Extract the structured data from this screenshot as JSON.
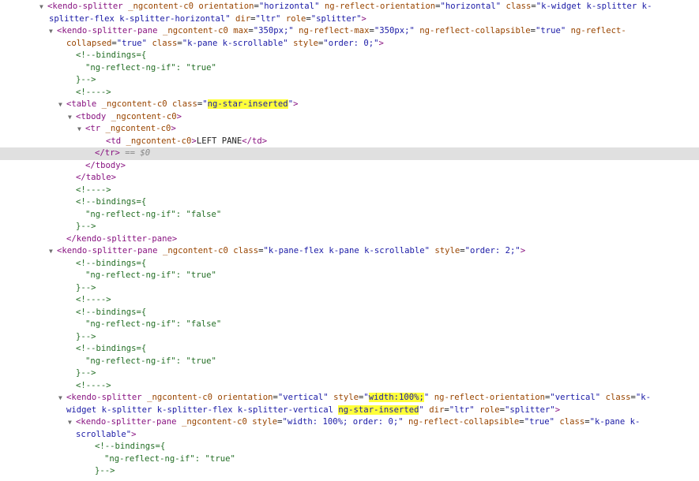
{
  "colors": {
    "tag": "#881280",
    "attr_name": "#994500",
    "attr_value": "#1a1aa6",
    "comment": "#236e25",
    "selected_row_bg": "#e0e0e0",
    "search_highlight": "#ffff3a"
  },
  "icons": {
    "expanded": "triangle-down-icon"
  },
  "lines": [
    {
      "indent": 62,
      "tri": true,
      "sel": false,
      "parts": [
        {
          "t": "tg",
          "v": "<kendo-splitter "
        },
        {
          "t": "an",
          "v": "_ngcontent-c0 orientation"
        },
        {
          "t": "tx",
          "v": "="
        },
        {
          "t": "av",
          "v": "\"horizontal\" "
        },
        {
          "t": "an",
          "v": "ng-reflect-orientation"
        },
        {
          "t": "tx",
          "v": "="
        },
        {
          "t": "av",
          "v": "\"horizontal\" "
        },
        {
          "t": "an",
          "v": "class"
        },
        {
          "t": "tx",
          "v": "="
        },
        {
          "t": "av",
          "v": "\"k-widget k-splitter k-"
        }
      ]
    },
    {
      "indent": 62,
      "tri": false,
      "sel": false,
      "parts": [
        {
          "t": "av",
          "v": "splitter-flex k-splitter-horizontal\" "
        },
        {
          "t": "an",
          "v": "dir"
        },
        {
          "t": "tx",
          "v": "="
        },
        {
          "t": "av",
          "v": "\"ltr\" "
        },
        {
          "t": "an",
          "v": "role"
        },
        {
          "t": "tx",
          "v": "="
        },
        {
          "t": "av",
          "v": "\"splitter\""
        },
        {
          "t": "tg",
          "v": ">"
        }
      ]
    },
    {
      "indent": 74,
      "tri": true,
      "sel": false,
      "parts": [
        {
          "t": "tg",
          "v": "<kendo-splitter-pane "
        },
        {
          "t": "an",
          "v": "_ngcontent-c0 max"
        },
        {
          "t": "tx",
          "v": "="
        },
        {
          "t": "av",
          "v": "\"350px;\" "
        },
        {
          "t": "an",
          "v": "ng-reflect-max"
        },
        {
          "t": "tx",
          "v": "="
        },
        {
          "t": "av",
          "v": "\"350px;\" "
        },
        {
          "t": "an",
          "v": "ng-reflect-collapsible"
        },
        {
          "t": "tx",
          "v": "="
        },
        {
          "t": "av",
          "v": "\"true\" "
        },
        {
          "t": "an",
          "v": "ng-reflect-"
        }
      ]
    },
    {
      "indent": 84,
      "tri": false,
      "sel": false,
      "parts": [
        {
          "t": "an",
          "v": "collapsed"
        },
        {
          "t": "tx",
          "v": "="
        },
        {
          "t": "av",
          "v": "\"true\" "
        },
        {
          "t": "an",
          "v": "class"
        },
        {
          "t": "tx",
          "v": "="
        },
        {
          "t": "av",
          "v": "\"k-pane k-scrollable\" "
        },
        {
          "t": "an",
          "v": "style"
        },
        {
          "t": "tx",
          "v": "="
        },
        {
          "t": "av",
          "v": "\"order: 0;\""
        },
        {
          "t": "tg",
          "v": ">"
        }
      ]
    },
    {
      "indent": 96,
      "tri": false,
      "sel": false,
      "parts": [
        {
          "t": "cm",
          "v": "<!--bindings={"
        }
      ]
    },
    {
      "indent": 108,
      "tri": false,
      "sel": false,
      "parts": [
        {
          "t": "cm",
          "v": "\"ng-reflect-ng-if\": \"true\""
        }
      ]
    },
    {
      "indent": 96,
      "tri": false,
      "sel": false,
      "parts": [
        {
          "t": "cm",
          "v": "}-->"
        }
      ]
    },
    {
      "indent": 96,
      "tri": false,
      "sel": false,
      "parts": [
        {
          "t": "cm",
          "v": "<!---->"
        }
      ]
    },
    {
      "indent": 86,
      "tri": true,
      "sel": false,
      "parts": [
        {
          "t": "tg",
          "v": "<table "
        },
        {
          "t": "an",
          "v": "_ngcontent-c0 class"
        },
        {
          "t": "tx",
          "v": "="
        },
        {
          "t": "av",
          "v": "\""
        },
        {
          "t": "av",
          "v": "ng-star-inserted",
          "hl": true
        },
        {
          "t": "av",
          "v": "\""
        },
        {
          "t": "tg",
          "v": ">"
        }
      ]
    },
    {
      "indent": 98,
      "tri": true,
      "sel": false,
      "parts": [
        {
          "t": "tg",
          "v": "<tbody "
        },
        {
          "t": "an",
          "v": "_ngcontent-c0"
        },
        {
          "t": "tg",
          "v": ">"
        }
      ]
    },
    {
      "indent": 110,
      "tri": true,
      "sel": false,
      "parts": [
        {
          "t": "tg",
          "v": "<tr "
        },
        {
          "t": "an",
          "v": "_ngcontent-c0"
        },
        {
          "t": "tg",
          "v": ">"
        }
      ]
    },
    {
      "indent": 134,
      "tri": false,
      "sel": false,
      "parts": [
        {
          "t": "tg",
          "v": "<td "
        },
        {
          "t": "an",
          "v": "_ngcontent-c0"
        },
        {
          "t": "tg",
          "v": ">"
        },
        {
          "t": "tx",
          "v": "LEFT PANE"
        },
        {
          "t": "tg",
          "v": "</td>"
        }
      ]
    },
    {
      "indent": 120,
      "tri": false,
      "sel": true,
      "parts": [
        {
          "t": "tg",
          "v": "</tr>"
        },
        {
          "t": "eq",
          "v": " == $0"
        }
      ]
    },
    {
      "indent": 108,
      "tri": false,
      "sel": false,
      "parts": [
        {
          "t": "tg",
          "v": "</tbody>"
        }
      ]
    },
    {
      "indent": 96,
      "tri": false,
      "sel": false,
      "parts": [
        {
          "t": "tg",
          "v": "</table>"
        }
      ]
    },
    {
      "indent": 96,
      "tri": false,
      "sel": false,
      "parts": [
        {
          "t": "cm",
          "v": "<!---->"
        }
      ]
    },
    {
      "indent": 96,
      "tri": false,
      "sel": false,
      "parts": [
        {
          "t": "cm",
          "v": "<!--bindings={"
        }
      ]
    },
    {
      "indent": 108,
      "tri": false,
      "sel": false,
      "parts": [
        {
          "t": "cm",
          "v": "\"ng-reflect-ng-if\": \"false\""
        }
      ]
    },
    {
      "indent": 96,
      "tri": false,
      "sel": false,
      "parts": [
        {
          "t": "cm",
          "v": "}-->"
        }
      ]
    },
    {
      "indent": 84,
      "tri": false,
      "sel": false,
      "parts": [
        {
          "t": "tg",
          "v": "</kendo-splitter-pane>"
        }
      ]
    },
    {
      "indent": 74,
      "tri": true,
      "sel": false,
      "parts": [
        {
          "t": "tg",
          "v": "<kendo-splitter-pane "
        },
        {
          "t": "an",
          "v": "_ngcontent-c0 class"
        },
        {
          "t": "tx",
          "v": "="
        },
        {
          "t": "av",
          "v": "\"k-pane-flex k-pane k-scrollable\" "
        },
        {
          "t": "an",
          "v": "style"
        },
        {
          "t": "tx",
          "v": "="
        },
        {
          "t": "av",
          "v": "\"order: 2;\""
        },
        {
          "t": "tg",
          "v": ">"
        }
      ]
    },
    {
      "indent": 96,
      "tri": false,
      "sel": false,
      "parts": [
        {
          "t": "cm",
          "v": "<!--bindings={"
        }
      ]
    },
    {
      "indent": 108,
      "tri": false,
      "sel": false,
      "parts": [
        {
          "t": "cm",
          "v": "\"ng-reflect-ng-if\": \"true\""
        }
      ]
    },
    {
      "indent": 96,
      "tri": false,
      "sel": false,
      "parts": [
        {
          "t": "cm",
          "v": "}-->"
        }
      ]
    },
    {
      "indent": 96,
      "tri": false,
      "sel": false,
      "parts": [
        {
          "t": "cm",
          "v": "<!---->"
        }
      ]
    },
    {
      "indent": 96,
      "tri": false,
      "sel": false,
      "parts": [
        {
          "t": "cm",
          "v": "<!--bindings={"
        }
      ]
    },
    {
      "indent": 108,
      "tri": false,
      "sel": false,
      "parts": [
        {
          "t": "cm",
          "v": "\"ng-reflect-ng-if\": \"false\""
        }
      ]
    },
    {
      "indent": 96,
      "tri": false,
      "sel": false,
      "parts": [
        {
          "t": "cm",
          "v": "}-->"
        }
      ]
    },
    {
      "indent": 96,
      "tri": false,
      "sel": false,
      "parts": [
        {
          "t": "cm",
          "v": "<!--bindings={"
        }
      ]
    },
    {
      "indent": 108,
      "tri": false,
      "sel": false,
      "parts": [
        {
          "t": "cm",
          "v": "\"ng-reflect-ng-if\": \"true\""
        }
      ]
    },
    {
      "indent": 96,
      "tri": false,
      "sel": false,
      "parts": [
        {
          "t": "cm",
          "v": "}-->"
        }
      ]
    },
    {
      "indent": 96,
      "tri": false,
      "sel": false,
      "parts": [
        {
          "t": "cm",
          "v": "<!---->"
        }
      ]
    },
    {
      "indent": 86,
      "tri": true,
      "sel": false,
      "parts": [
        {
          "t": "tg",
          "v": "<kendo-splitter "
        },
        {
          "t": "an",
          "v": "_ngcontent-c0 orientation"
        },
        {
          "t": "tx",
          "v": "="
        },
        {
          "t": "av",
          "v": "\"vertical\" "
        },
        {
          "t": "an",
          "v": "style"
        },
        {
          "t": "tx",
          "v": "="
        },
        {
          "t": "av",
          "v": "\""
        },
        {
          "t": "av",
          "v": "width:100%;",
          "hl": true
        },
        {
          "t": "av",
          "v": "\" "
        },
        {
          "t": "an",
          "v": "ng-reflect-orientation"
        },
        {
          "t": "tx",
          "v": "="
        },
        {
          "t": "av",
          "v": "\"vertical\" "
        },
        {
          "t": "an",
          "v": "class"
        },
        {
          "t": "tx",
          "v": "="
        },
        {
          "t": "av",
          "v": "\"k-"
        }
      ]
    },
    {
      "indent": 84,
      "tri": false,
      "sel": false,
      "parts": [
        {
          "t": "av",
          "v": "widget k-splitter k-splitter-flex k-splitter-vertical "
        },
        {
          "t": "av",
          "v": "ng-star-inserted",
          "hl": true
        },
        {
          "t": "av",
          "v": "\" "
        },
        {
          "t": "an",
          "v": "dir"
        },
        {
          "t": "tx",
          "v": "="
        },
        {
          "t": "av",
          "v": "\"ltr\" "
        },
        {
          "t": "an",
          "v": "role"
        },
        {
          "t": "tx",
          "v": "="
        },
        {
          "t": "av",
          "v": "\"splitter\""
        },
        {
          "t": "tg",
          "v": ">"
        }
      ]
    },
    {
      "indent": 98,
      "tri": true,
      "sel": false,
      "parts": [
        {
          "t": "tg",
          "v": "<kendo-splitter-pane "
        },
        {
          "t": "an",
          "v": "_ngcontent-c0 style"
        },
        {
          "t": "tx",
          "v": "="
        },
        {
          "t": "av",
          "v": "\"width: 100%; order: 0;\" "
        },
        {
          "t": "an",
          "v": "ng-reflect-collapsible"
        },
        {
          "t": "tx",
          "v": "="
        },
        {
          "t": "av",
          "v": "\"true\" "
        },
        {
          "t": "an",
          "v": "class"
        },
        {
          "t": "tx",
          "v": "="
        },
        {
          "t": "av",
          "v": "\"k-pane k-"
        }
      ]
    },
    {
      "indent": 96,
      "tri": false,
      "sel": false,
      "parts": [
        {
          "t": "av",
          "v": "scrollable\""
        },
        {
          "t": "tg",
          "v": ">"
        }
      ]
    },
    {
      "indent": 120,
      "tri": false,
      "sel": false,
      "parts": [
        {
          "t": "cm",
          "v": "<!--bindings={"
        }
      ]
    },
    {
      "indent": 132,
      "tri": false,
      "sel": false,
      "parts": [
        {
          "t": "cm",
          "v": "\"ng-reflect-ng-if\": \"true\""
        }
      ]
    },
    {
      "indent": 120,
      "tri": false,
      "sel": false,
      "parts": [
        {
          "t": "cm",
          "v": "}-->"
        }
      ]
    }
  ]
}
